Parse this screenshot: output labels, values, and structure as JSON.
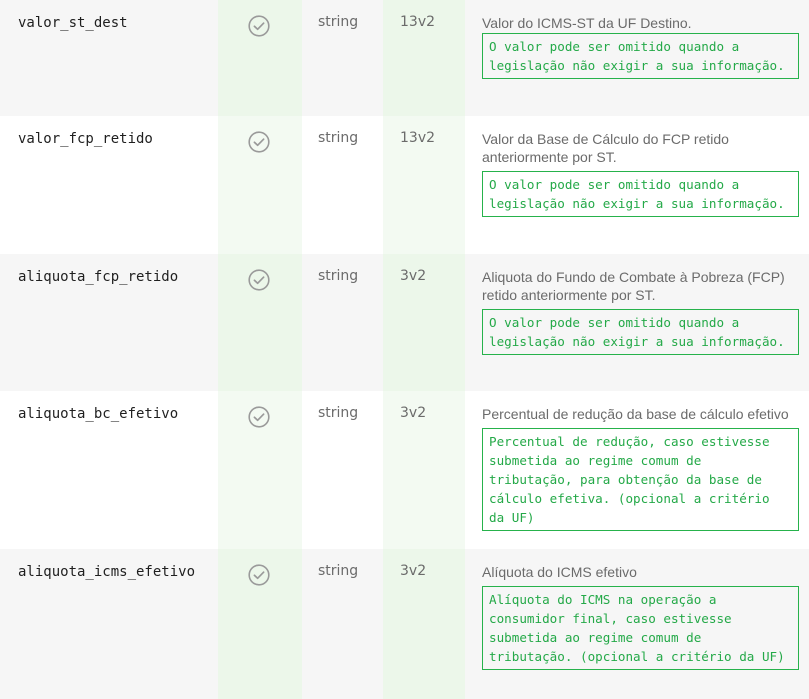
{
  "rows": [
    {
      "name": "valor_st_dest",
      "type": "string",
      "version": "13v2",
      "description": "Valor do ICMS-ST da UF Destino.",
      "note": "O valor pode ser omitido quando a legislação não exigir a sua informação.",
      "required_icon": "check-circle-icon"
    },
    {
      "name": "valor_fcp_retido",
      "type": "string",
      "version": "13v2",
      "description": "Valor da Base de Cálculo do FCP retido anteriormente por ST.",
      "note": "O valor pode ser omitido quando a legislação não exigir a sua informação.",
      "required_icon": "check-circle-icon"
    },
    {
      "name": "aliquota_fcp_retido",
      "type": "string",
      "version": "3v2",
      "description": "Aliquota do Fundo de Combate à Pobreza (FCP) retido anteriormente por ST.",
      "note": "O valor pode ser omitido quando a legislação não exigir a sua informação.",
      "required_icon": "check-circle-icon"
    },
    {
      "name": "aliquota_bc_efetivo",
      "type": "string",
      "version": "3v2",
      "description": "Percentual de redução da base de cálculo efetivo",
      "note": "Percentual de redução, caso estivesse submetida ao regime comum de tributação, para obtenção da base de cálculo efetiva. (opcional a critério da UF)",
      "required_icon": "check-circle-icon"
    },
    {
      "name": "aliquota_icms_efetivo",
      "type": "string",
      "version": "3v2",
      "description": "Alíquota do ICMS efetivo",
      "note": "Alíquota do ICMS na operação a consumidor final, caso estivesse submetida ao regime comum de tributação. (opcional a critério da UF)",
      "required_icon": "check-circle-icon"
    }
  ],
  "colors": {
    "note_border": "#26b24b",
    "note_text": "#24a948",
    "check_icon": "#9a9a9a",
    "row_odd": "#f6f6f6",
    "column_tint": "#ecf7ea"
  }
}
